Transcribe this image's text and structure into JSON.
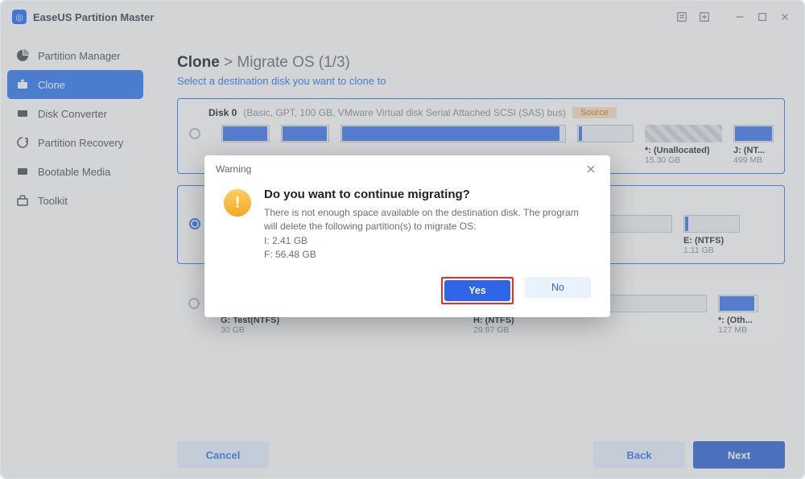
{
  "titlebar": {
    "title": "EaseUS Partition Master"
  },
  "sidebar": {
    "items": [
      {
        "label": "Partition Manager"
      },
      {
        "label": "Clone"
      },
      {
        "label": "Disk Converter"
      },
      {
        "label": "Partition Recovery"
      },
      {
        "label": "Bootable Media"
      },
      {
        "label": "Toolkit"
      }
    ]
  },
  "header": {
    "strong": "Clone",
    "rest": " > Migrate OS (1/3)",
    "subtext": "Select a destination disk you want to clone to"
  },
  "disks": [
    {
      "title": "Disk 0",
      "meta": "(Basic, GPT, 100 GB, VMware   Virtual disk   Serial Attached SCSI (SAS) bus)",
      "source": "Source",
      "partitions": [
        {
          "label": "*: (Unallocated)",
          "size": "15.30 GB",
          "unalloc": true
        },
        {
          "label": "J: (NT...",
          "size": "499 MB"
        }
      ]
    },
    {
      "title": "",
      "partitions": [
        {
          "label": "E: (NTFS)",
          "size": "1.11 GB"
        }
      ]
    },
    {
      "title": "",
      "partitions": [
        {
          "label": "G: Test(NTFS)",
          "size": "30 GB"
        },
        {
          "label": "H: (NTFS)",
          "size": "29.87 GB"
        },
        {
          "label": "*: (Oth...",
          "size": "127 MB"
        }
      ]
    }
  ],
  "footer": {
    "cancel": "Cancel",
    "back": "Back",
    "next": "Next"
  },
  "dialog": {
    "head": "Warning",
    "title": "Do you want to continue migrating?",
    "line1": "There is not enough space available on the destination disk. The program will delete the following partition(s) to migrate OS:",
    "line2": "I: 2.41 GB",
    "line3": "F: 56.48 GB",
    "yes": "Yes",
    "no": "No"
  }
}
